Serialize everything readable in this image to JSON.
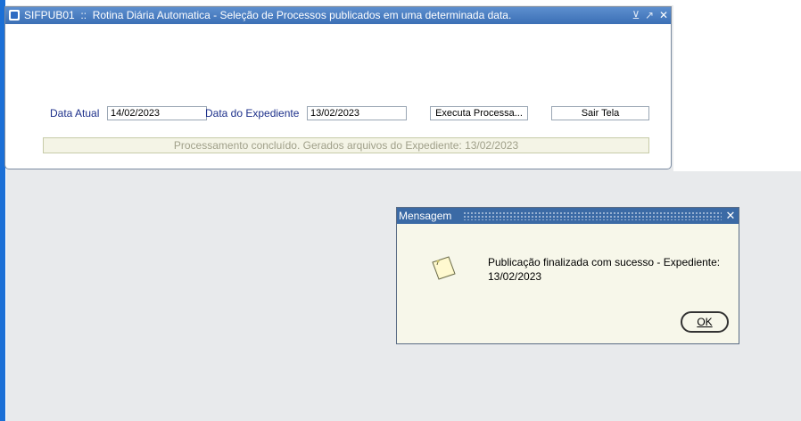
{
  "main_window": {
    "form_code": "SIFPUB01",
    "separator": "::",
    "title": "Rotina Diária Automatica - Seleção de Processos publicados em uma determinada data.",
    "controls": {
      "minimize": "⊻",
      "maximize": "↗",
      "close": "✕"
    }
  },
  "form": {
    "data_atual_label": "Data Atual",
    "data_atual_value": "14/02/2023",
    "data_expediente_label": "Data do Expediente",
    "data_expediente_value": "13/02/2023",
    "executa_button": "Executa Processa...",
    "sair_button": "Sair Tela",
    "status_message": "Processamento concluído. Gerados arquivos do Expediente: 13/02/2023"
  },
  "message_dialog": {
    "title": "Mensagem",
    "close": "✕",
    "icon": "note-icon",
    "text": "Publicação finalizada com sucesso - Expediente: 13/02/2023",
    "ok_button": "OK"
  },
  "colors": {
    "title_bar": "#3b6fb5",
    "label_text": "#1c2f8a",
    "dialog_background": "#f7f7ea",
    "status_text": "#a0a08a"
  }
}
